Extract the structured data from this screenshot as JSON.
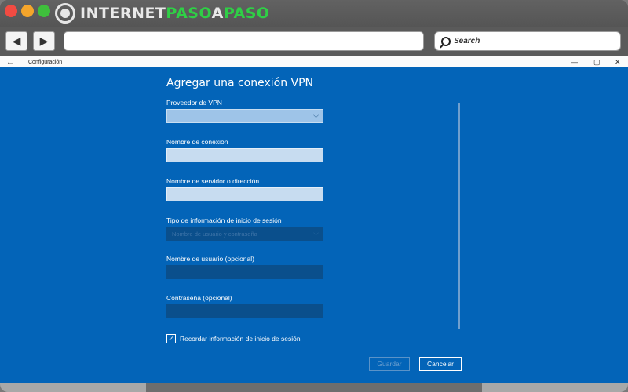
{
  "browser": {
    "logo": {
      "part1": "INTERNET",
      "part2": "PASO",
      "part3": "A",
      "part4": "PASO"
    },
    "back_icon": "◀",
    "forward_icon": "▶",
    "address_value": "",
    "search_label": "Search"
  },
  "window": {
    "title": "Configuración",
    "back_icon": "←",
    "minimize_icon": "—",
    "maximize_icon": "▢",
    "close_icon": "✕"
  },
  "dialog": {
    "title": "Agregar una conexión VPN",
    "fields": [
      {
        "label": "Proveedor de VPN",
        "type": "select",
        "value": ""
      },
      {
        "label": "Nombre de conexión",
        "type": "text",
        "value": ""
      },
      {
        "label": "Nombre de servidor o dirección",
        "type": "text",
        "value": ""
      },
      {
        "label": "Tipo de información de inicio de sesión",
        "type": "select",
        "value": "Nombre de usuario y contraseña"
      },
      {
        "label": "Nombre de usuario (opcional)",
        "type": "text",
        "value": ""
      },
      {
        "label": "Contraseña (opcional)",
        "type": "password",
        "value": ""
      }
    ],
    "remember_checkbox": {
      "label": "Recordar información de inicio de sesión",
      "checked": true,
      "check_glyph": "✓"
    },
    "chevron_glyph": "⌵",
    "save_label": "Guardar",
    "cancel_label": "Cancelar"
  },
  "colors": {
    "content_bg": "#0364b8",
    "accent_green": "#2fcf46"
  }
}
